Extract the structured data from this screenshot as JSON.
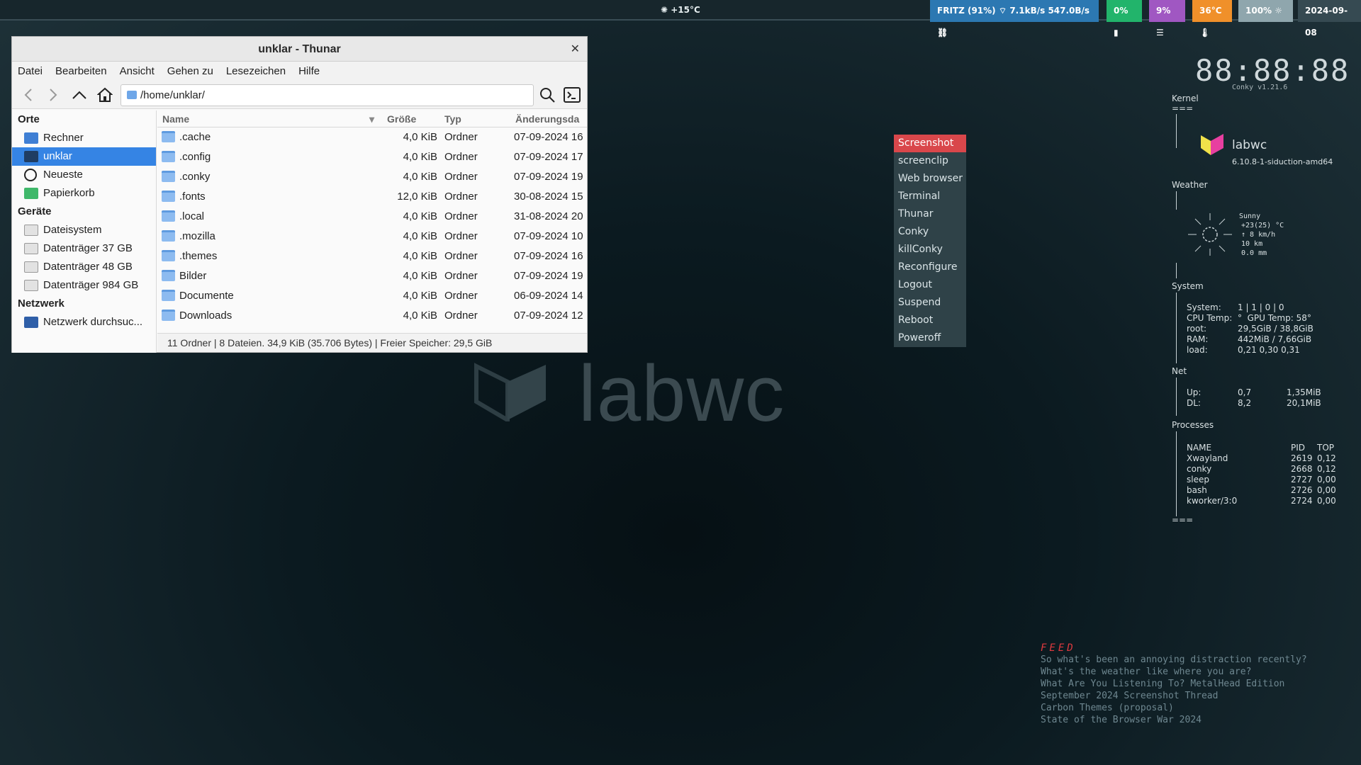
{
  "topbar": {
    "weather": "+15°C",
    "network": "FRITZ (91%)",
    "net_down": "7.1kB/s",
    "net_up": "547.0B/s",
    "battery": "0%",
    "cpu": "9%",
    "temperature": "36°C",
    "brightness": "100%",
    "date": "2024-09-08",
    "colors": {
      "network": "#2c78b2",
      "battery": "#22b46b",
      "cpu": "#a057c2",
      "temp": "#f0902a",
      "brightness": "#8fa6ad"
    }
  },
  "thunar": {
    "title": "unklar - Thunar",
    "menu": [
      "Datei",
      "Bearbeiten",
      "Ansicht",
      "Gehen zu",
      "Lesezeichen",
      "Hilfe"
    ],
    "location": "/home/unklar/",
    "sidebar": {
      "orte_label": "Orte",
      "orte": [
        "Rechner",
        "unklar",
        "Neueste",
        "Papierkorb"
      ],
      "geraete_label": "Geräte",
      "geraete": [
        "Dateisystem",
        "Datenträger 37 GB",
        "Datenträger 48 GB",
        "Datenträger 984 GB"
      ],
      "netzwerk_label": "Netzwerk",
      "netzwerk": [
        "Netzwerk durchsuc..."
      ]
    },
    "columns": {
      "name": "Name",
      "size": "Größe",
      "type": "Typ",
      "date": "Änderungsda"
    },
    "files": [
      {
        "name": ".cache",
        "size": "4,0 KiB",
        "type": "Ordner",
        "date": "07-09-2024 16"
      },
      {
        "name": ".config",
        "size": "4,0 KiB",
        "type": "Ordner",
        "date": "07-09-2024 17"
      },
      {
        "name": ".conky",
        "size": "4,0 KiB",
        "type": "Ordner",
        "date": "07-09-2024 19"
      },
      {
        "name": ".fonts",
        "size": "12,0 KiB",
        "type": "Ordner",
        "date": "30-08-2024 15"
      },
      {
        "name": ".local",
        "size": "4,0 KiB",
        "type": "Ordner",
        "date": "31-08-2024 20"
      },
      {
        "name": ".mozilla",
        "size": "4,0 KiB",
        "type": "Ordner",
        "date": "07-09-2024 10"
      },
      {
        "name": ".themes",
        "size": "4,0 KiB",
        "type": "Ordner",
        "date": "07-09-2024 16"
      },
      {
        "name": "Bilder",
        "size": "4,0 KiB",
        "type": "Ordner",
        "date": "07-09-2024 19"
      },
      {
        "name": "Documente",
        "size": "4,0 KiB",
        "type": "Ordner",
        "date": "06-09-2024 14"
      },
      {
        "name": "Downloads",
        "size": "4,0 KiB",
        "type": "Ordner",
        "date": "07-09-2024 12"
      }
    ],
    "status": "11 Ordner  |  8 Dateien. 34,9 KiB (35.706 Bytes)  |  Freier Speicher: 29,5 GiB"
  },
  "watermark": "labwc",
  "menu": [
    "Screenshot",
    "screenclip",
    "Web browser",
    "Terminal",
    "Thunar",
    "Conky",
    "killConky",
    "Reconfigure",
    "Logout",
    "Suspend",
    "Reboot",
    "Poweroff"
  ],
  "conky": {
    "clock": "88:88:88",
    "version": "Conky v1.21.6",
    "kernel_label": "Kernel",
    "sep": "===",
    "logo_text": "labwc",
    "kernel": "6.10.8-1-siduction-amd64",
    "weather_label": "Weather",
    "weather_desc": "Sunny",
    "weather_temp": "+23(25) °C",
    "weather_wind": "↑ 8 km/h",
    "weather_vis": "10 km",
    "weather_rain": "0.0 mm",
    "system_label": "System",
    "system": [
      {
        "k": "System:",
        "v": "1 | 1 | 0 | 0"
      },
      {
        "k": "CPU Temp:",
        "v": "°  GPU Temp: 58°"
      },
      {
        "k": "root:",
        "v": "29,5GiB / 38,8GiB"
      },
      {
        "k": "RAM:",
        "v": "442MiB / 7,66GiB"
      },
      {
        "k": "load:",
        "v": "0,21 0,30 0,31"
      }
    ],
    "net_label": "Net",
    "net": [
      {
        "k": "Up:",
        "a": "0,7",
        "b": "1,35MiB"
      },
      {
        "k": "DL:",
        "a": "8,2",
        "b": "20,1MiB"
      }
    ],
    "proc_label": "Processes",
    "proc_head": {
      "name": "NAME",
      "pid": "PID",
      "top": "TOP"
    },
    "procs": [
      {
        "name": "Xwayland",
        "pid": "2619",
        "top": "0,12"
      },
      {
        "name": "conky",
        "pid": "2668",
        "top": "0,12"
      },
      {
        "name": "sleep",
        "pid": "2727",
        "top": "0,00"
      },
      {
        "name": "bash",
        "pid": "2726",
        "top": "0,00"
      },
      {
        "name": "kworker/3:0",
        "pid": "2724",
        "top": "0,00"
      }
    ]
  },
  "feed": {
    "title": "FEED",
    "items": [
      "So what's been an annoying distraction recently?",
      "What's the weather like where you are?",
      "What Are You Listening To? MetalHead Edition",
      "September 2024 Screenshot Thread",
      "Carbon Themes (proposal)",
      "State of the Browser War 2024"
    ]
  }
}
